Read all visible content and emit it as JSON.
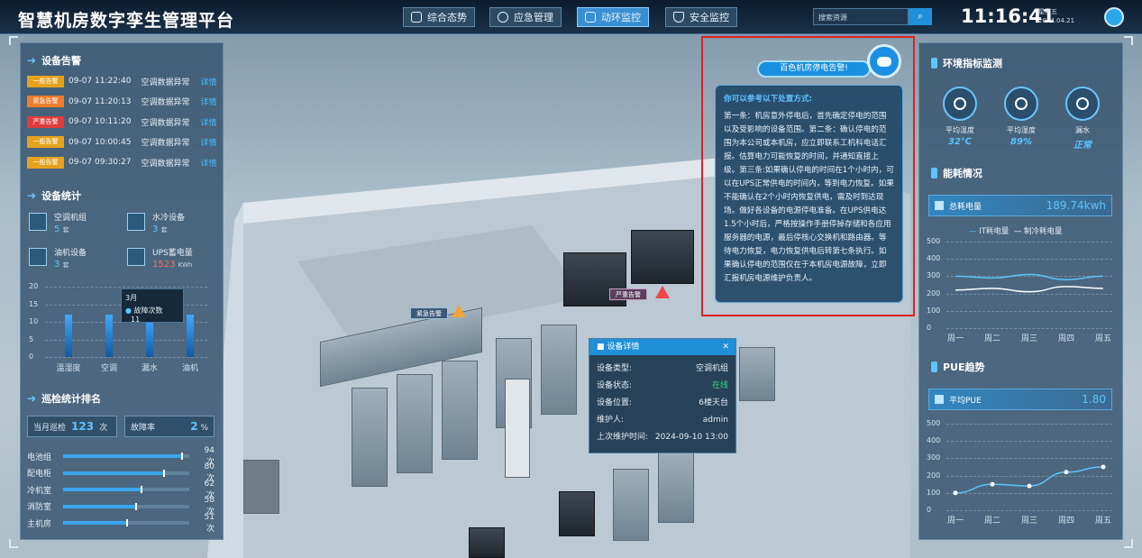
{
  "header": {
    "title": "智慧机房数字孪生管理平台",
    "nav": [
      "综合态势",
      "应急管理",
      "动环监控",
      "安全监控"
    ],
    "active_nav": "动环监控",
    "search_placeholder": "搜索资源",
    "time": "11:16:41",
    "weekday": "星期五",
    "date": "2024.04.21"
  },
  "alarms": {
    "title": "设备告警",
    "items": [
      {
        "level": "一般告警",
        "color": "#e6a21d",
        "time": "09-07 11:22:40",
        "msg": "空调数据异常",
        "link": "详情"
      },
      {
        "level": "紧急告警",
        "color": "#ef7d2e",
        "time": "09-07 11:20:13",
        "msg": "空调数据异常",
        "link": "详情"
      },
      {
        "level": "严重告警",
        "color": "#e03c3c",
        "time": "09-07 10:11:20",
        "msg": "空调数据异常",
        "link": "详情"
      },
      {
        "level": "一般告警",
        "color": "#e6a21d",
        "time": "09-07 10:00:45",
        "msg": "空调数据异常",
        "link": "详情"
      },
      {
        "level": "一般告警",
        "color": "#e6a21d",
        "time": "09-07 09:30:27",
        "msg": "空调数据异常",
        "link": "详情"
      }
    ]
  },
  "stats": {
    "title": "设备统计",
    "items": [
      {
        "name": "空调机组",
        "value": "5",
        "unit": "套"
      },
      {
        "name": "水冷设备",
        "value": "3",
        "unit": "套"
      },
      {
        "name": "油机设备",
        "value": "3",
        "unit": "套"
      },
      {
        "name": "UPS蓄电量",
        "value": "1523",
        "unit": "KWh"
      }
    ],
    "chart": {
      "y_ticks": [
        "20",
        "15",
        "10",
        "5",
        "0"
      ],
      "categories": [
        "温湿度",
        "空调",
        "漏水",
        "油机"
      ],
      "values": [
        12,
        12,
        11,
        12
      ],
      "tooltip_month": "3月",
      "tooltip_label": "故障次数",
      "tooltip_value": "11"
    }
  },
  "patrol": {
    "title": "巡检统计排名",
    "current_label": "当月巡检",
    "current_value": "123",
    "current_unit": "次",
    "fail_label": "故障率",
    "fail_value": "2",
    "fail_unit": "%",
    "ranking": [
      {
        "name": "电池组",
        "value": 94,
        "label": "94次"
      },
      {
        "name": "配电柜",
        "value": 80,
        "label": "80次"
      },
      {
        "name": "冷机室",
        "value": 62,
        "label": "62次"
      },
      {
        "name": "消防室",
        "value": 58,
        "label": "58次"
      },
      {
        "name": "主机房",
        "value": 51,
        "label": "51次"
      }
    ]
  },
  "emergency": {
    "bubble": "百色机房停电告警!",
    "heading": "你可以参考以下处置方式:",
    "text": "第一条：机房意外停电后，首先确定停电的范围以及受影响的设备范围。第二条：确认停电的范围为本公司或本机房，应立即联系工机科电话汇报。估算电力可能恢复的时间，并通知直接上级。第三条:如果确认停电的时间在1个小时内，可以在UPS正常供电的时间内，等到电力恢复。如果不能确认在2个小时内恢复供电，需及时到达现场。做好各设备的电源停电准备。在UPS供电达1.5个小时后，严格按操作手册停掉存储和各应用服务器的电源，最后停核心交换机和路由器。等待电力恢复，电力恢复供电后转第七条执行。如果确认停电的范围仅在于本机房电源故障，立即汇报机房电源维护负责人。"
  },
  "scene_tags": {
    "emergency_tag": "紧急告警",
    "critical_tag": "严重告警"
  },
  "device_card": {
    "title": "设备详情",
    "rows": [
      {
        "k": "设备类型:",
        "v": "空调机组"
      },
      {
        "k": "设备状态:",
        "v": "在线"
      },
      {
        "k": "设备位置:",
        "v": "6楼天台"
      },
      {
        "k": "维护人:",
        "v": "admin"
      },
      {
        "k": "上次维护时间:",
        "v": "2024-09-10 13:00"
      }
    ]
  },
  "env": {
    "title": "环境指标监测",
    "gauges": [
      {
        "name": "平均温度",
        "value": "32℃",
        "icon": "thermometer-icon"
      },
      {
        "name": "平均湿度",
        "value": "89%",
        "icon": "humidity-icon"
      },
      {
        "name": "漏水",
        "value": "正常",
        "icon": "water-leak-icon"
      }
    ]
  },
  "energy": {
    "title": "能耗情况",
    "total_label": "总耗电量",
    "total_value": "189.74kwh",
    "legend": [
      "IT耗电量",
      "制冷耗电量"
    ],
    "y_ticks": [
      "500",
      "400",
      "300",
      "200",
      "100",
      "0"
    ],
    "x_ticks": [
      "周一",
      "周二",
      "周三",
      "周四",
      "周五"
    ]
  },
  "pue": {
    "title": "PUE趋势",
    "label": "平均PUE",
    "value": "1.80",
    "y_ticks": [
      "500",
      "400",
      "300",
      "200",
      "100",
      "0"
    ],
    "x_ticks": [
      "周一",
      "周二",
      "周三",
      "周四",
      "周五"
    ]
  },
  "chart_data": [
    {
      "type": "bar",
      "categories": [
        "温湿度",
        "空调",
        "漏水",
        "油机"
      ],
      "values": [
        12,
        12,
        11,
        12
      ],
      "ylim": [
        0,
        20
      ]
    },
    {
      "type": "line",
      "x": [
        "周一",
        "周二",
        "周三",
        "周四",
        "周五"
      ],
      "series": [
        {
          "name": "IT耗电量",
          "values": [
            300,
            290,
            310,
            280,
            300
          ]
        },
        {
          "name": "制冷耗电量",
          "values": [
            220,
            230,
            210,
            240,
            230
          ]
        }
      ],
      "ylim": [
        0,
        500
      ]
    },
    {
      "type": "line",
      "x": [
        "周一",
        "周二",
        "周三",
        "周四",
        "周五"
      ],
      "series": [
        {
          "values": [
            100,
            150,
            140,
            220,
            250
          ]
        }
      ],
      "ylim": [
        0,
        500
      ]
    }
  ]
}
